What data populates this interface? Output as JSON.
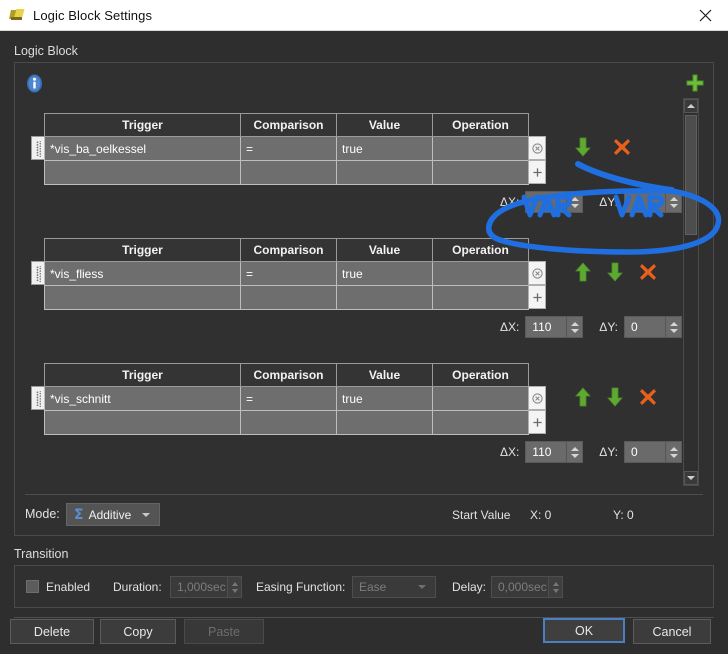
{
  "window": {
    "title": "Logic Block Settings",
    "app_icon": "app-icon",
    "close_icon": "close-icon"
  },
  "groups": {
    "logic_block_label": "Logic Block",
    "transition_label": "Transition"
  },
  "toolbar": {
    "info_icon": "info-icon",
    "add_icon": "plus-icon"
  },
  "table": {
    "columns": [
      "Trigger",
      "Comparison",
      "Value",
      "Operation"
    ],
    "empty_cell": ""
  },
  "blocks": [
    {
      "trigger": "*vis_ba_oelkessel",
      "comparison": "=",
      "value": "true",
      "operation": "",
      "dx_label": "ΔX:",
      "dy_label": "ΔY:",
      "dx": "",
      "dy": "",
      "has_up": false,
      "has_down": true,
      "clear_icon": "clear-row-icon",
      "add_icon": "add-row-icon",
      "up_icon": "move-up-icon",
      "down_icon": "move-down-icon",
      "delete_icon": "delete-block-icon"
    },
    {
      "trigger": "*vis_fliess",
      "comparison": "=",
      "value": "true",
      "operation": "",
      "dx_label": "ΔX:",
      "dy_label": "ΔY:",
      "dx": "110",
      "dy": "0",
      "has_up": true,
      "has_down": true,
      "clear_icon": "clear-row-icon",
      "add_icon": "add-row-icon",
      "up_icon": "move-up-icon",
      "down_icon": "move-down-icon",
      "delete_icon": "delete-block-icon"
    },
    {
      "trigger": "*vis_schnitt",
      "comparison": "=",
      "value": "true",
      "operation": "",
      "dx_label": "ΔX:",
      "dy_label": "ΔY:",
      "dx": "110",
      "dy": "0",
      "has_up": true,
      "has_down": true,
      "clear_icon": "clear-row-icon",
      "add_icon": "add-row-icon",
      "up_icon": "move-up-icon",
      "down_icon": "move-down-icon",
      "delete_icon": "delete-block-icon"
    }
  ],
  "scrollbar": {
    "up_icon": "scroll-up-icon",
    "down_icon": "scroll-down-icon"
  },
  "mode": {
    "label": "Mode:",
    "symbol": "Σ",
    "value": "Additive",
    "caret_icon": "chevron-down-icon"
  },
  "start_value": {
    "label": "Start Value",
    "x": "X: 0",
    "y": "Y: 0"
  },
  "transition": {
    "enabled_label": "Enabled",
    "enabled_checked": false,
    "duration_label": "Duration:",
    "duration_value": "1,000sec",
    "easing_label": "Easing Function:",
    "easing_value": "Ease",
    "delay_label": "Delay:",
    "delay_value": "0,000sec"
  },
  "footer": {
    "delete": "Delete",
    "copy": "Copy",
    "paste": "Paste",
    "ok": "OK",
    "cancel": "Cancel"
  },
  "annotation": {
    "text_dx": "VAR",
    "text_dy": "VAR",
    "color": "#1f6fe0",
    "shape": "ellipse-highlight"
  },
  "colors": {
    "accent_green": "#6eaa3a",
    "accent_orange": "#e8601c",
    "info_blue": "#3a6fb5",
    "focus_blue": "#4a7fc1",
    "marker_blue": "#1f6fe0"
  }
}
